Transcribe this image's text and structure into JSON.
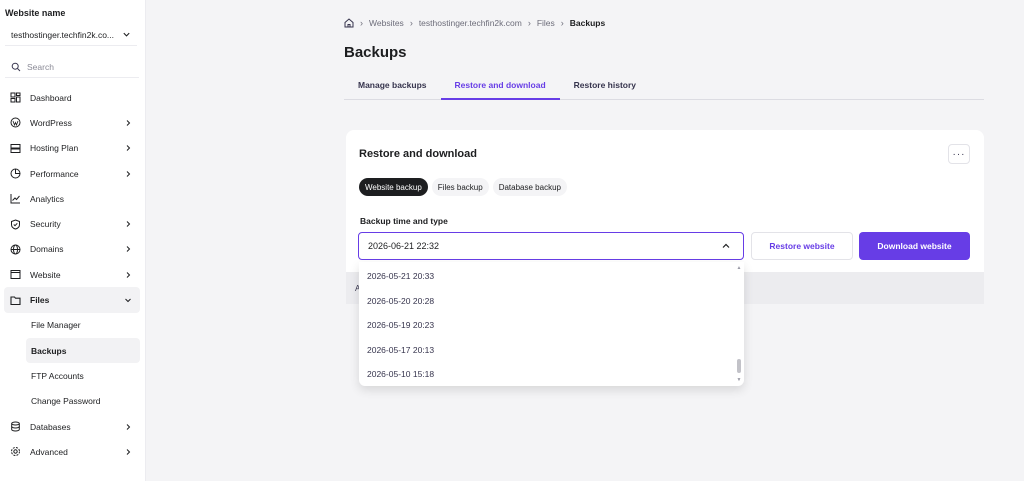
{
  "sidebar": {
    "site_label": "Website name",
    "site_value": "testhostinger.techfin2k.co...",
    "search_placeholder": "Search",
    "items": [
      {
        "label": "Dashboard"
      },
      {
        "label": "WordPress"
      },
      {
        "label": "Hosting Plan"
      },
      {
        "label": "Performance"
      },
      {
        "label": "Analytics"
      },
      {
        "label": "Security"
      },
      {
        "label": "Domains"
      },
      {
        "label": "Website"
      },
      {
        "label": "Files"
      },
      {
        "label": "Databases"
      },
      {
        "label": "Advanced"
      }
    ],
    "sub_items": [
      {
        "label": "File Manager"
      },
      {
        "label": "Backups"
      },
      {
        "label": "FTP Accounts"
      },
      {
        "label": "Change Password"
      }
    ]
  },
  "breadcrumb": {
    "items": [
      "Websites",
      "testhostinger.techfin2k.com",
      "Files"
    ],
    "current": "Backups"
  },
  "page": {
    "title": "Backups"
  },
  "tabs": [
    {
      "label": "Manage backups"
    },
    {
      "label": "Restore and download"
    },
    {
      "label": "Restore history"
    }
  ],
  "card": {
    "title": "Restore and download",
    "more_label": "···",
    "chips": [
      {
        "label": "Website backup"
      },
      {
        "label": "Files backup"
      },
      {
        "label": "Database backup"
      }
    ],
    "field_label": "Backup time and type",
    "selected_value": "2026-06-21 22:32",
    "restore_label": "Restore website",
    "download_label": "Download website"
  },
  "band": {
    "left_text": "A",
    "right_text": "."
  },
  "dropdown": {
    "options": [
      "2026-05-21 20:33",
      "2026-05-20 20:28",
      "2026-05-19 20:23",
      "2026-05-17 20:13",
      "2026-05-10 15:18"
    ]
  },
  "colors": {
    "accent": "#673de6",
    "text": "#1d1e20",
    "chip_active": "#1d1e20"
  }
}
